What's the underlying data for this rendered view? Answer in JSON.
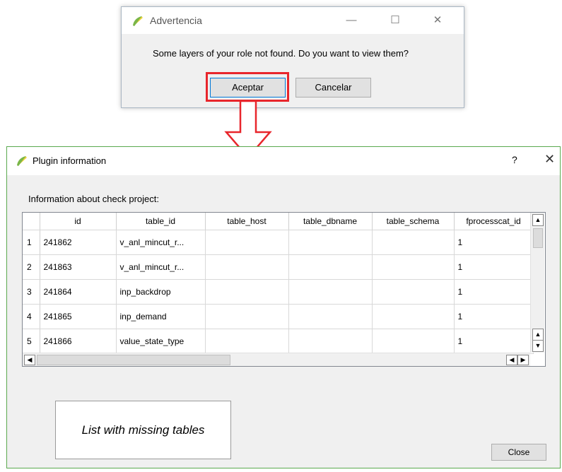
{
  "warning_dialog": {
    "title": "Advertencia",
    "message": "Some layers of your role not found. Do you want to view them?",
    "accept_label": "Aceptar",
    "cancel_label": "Cancelar",
    "minimize_glyph": "—",
    "maximize_glyph": "☐",
    "close_glyph": "✕"
  },
  "plugin_dialog": {
    "title": "Plugin information",
    "help_glyph": "?",
    "close_glyph": "✕",
    "info_label": "Information about check project:",
    "close_button_label": "Close",
    "callout_text": "List with missing tables"
  },
  "table": {
    "columns": [
      "id",
      "table_id",
      "table_host",
      "table_dbname",
      "table_schema",
      "fprocesscat_id"
    ],
    "rows": [
      {
        "n": "1",
        "id": "241862",
        "table_id": "v_anl_mincut_r...",
        "table_host": "",
        "table_dbname": "",
        "table_schema": "",
        "fprocesscat_id": "1"
      },
      {
        "n": "2",
        "id": "241863",
        "table_id": "v_anl_mincut_r...",
        "table_host": "",
        "table_dbname": "",
        "table_schema": "",
        "fprocesscat_id": "1"
      },
      {
        "n": "3",
        "id": "241864",
        "table_id": "inp_backdrop",
        "table_host": "",
        "table_dbname": "",
        "table_schema": "",
        "fprocesscat_id": "1"
      },
      {
        "n": "4",
        "id": "241865",
        "table_id": "inp_demand",
        "table_host": "",
        "table_dbname": "",
        "table_schema": "",
        "fprocesscat_id": "1"
      },
      {
        "n": "5",
        "id": "241866",
        "table_id": "value_state_type",
        "table_host": "",
        "table_dbname": "",
        "table_schema": "",
        "fprocesscat_id": "1"
      }
    ]
  },
  "colors": {
    "highlight": "#e8262c",
    "dialog_border": "#5aa94e",
    "qgis_green": "#7ab648",
    "qgis_yellow": "#f1d23a"
  },
  "icons": {
    "app_logo": "qgis-logo-icon",
    "arrow": "down-arrow-annotation"
  }
}
